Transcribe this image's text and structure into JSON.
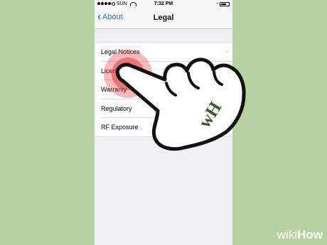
{
  "status_bar": {
    "carrier": "SUN",
    "time": "7:32 PM"
  },
  "nav": {
    "back_label": "About",
    "title": "Legal"
  },
  "list": {
    "items": [
      {
        "label": "Legal Notices"
      },
      {
        "label": "License"
      },
      {
        "label": "Warranty"
      },
      {
        "label": "Regulatory"
      },
      {
        "label": "RF Exposure"
      }
    ]
  },
  "watermark": {
    "wiki": "wiki",
    "how": "How",
    "badge": "wH"
  },
  "colors": {
    "background": "#b8d1a1",
    "accent": "#1b7ef7",
    "tap_indicator": "#e8383d"
  }
}
